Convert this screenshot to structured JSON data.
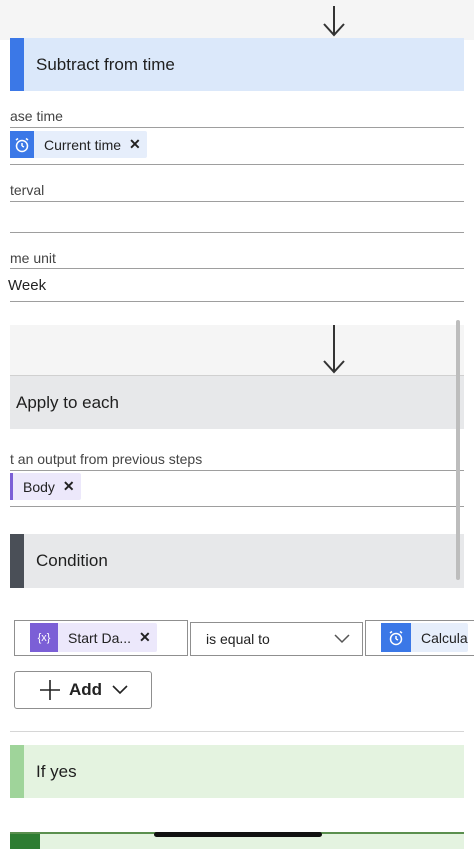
{
  "subtract": {
    "title": "Subtract from time",
    "base_time_label": "ase time",
    "base_time_token": "Current time",
    "interval_label": "terval",
    "time_unit_label": "me unit",
    "time_unit_value": "Week"
  },
  "apply_each": {
    "title": "Apply to each",
    "output_label": "t an output from previous steps",
    "output_token": "Body"
  },
  "condition": {
    "title": "Condition",
    "left_token": "Start Da...",
    "left_icon": "{x}",
    "operator": "is equal to",
    "right_token": "Calcula",
    "add_label": "Add"
  },
  "if_yes": {
    "title": "If yes"
  },
  "close_glyph": "✕",
  "colors": {
    "subtract_header": "#dbe8fa",
    "subtract_bar": "#3b78e7",
    "gray_header": "#e7e8ea",
    "condition_bar": "#4a4f57",
    "token_blue": "#3b78e7",
    "token_purple": "#7b5fd6",
    "yes_header": "#e4f3e0",
    "yes_bar": "#9fd49a"
  }
}
